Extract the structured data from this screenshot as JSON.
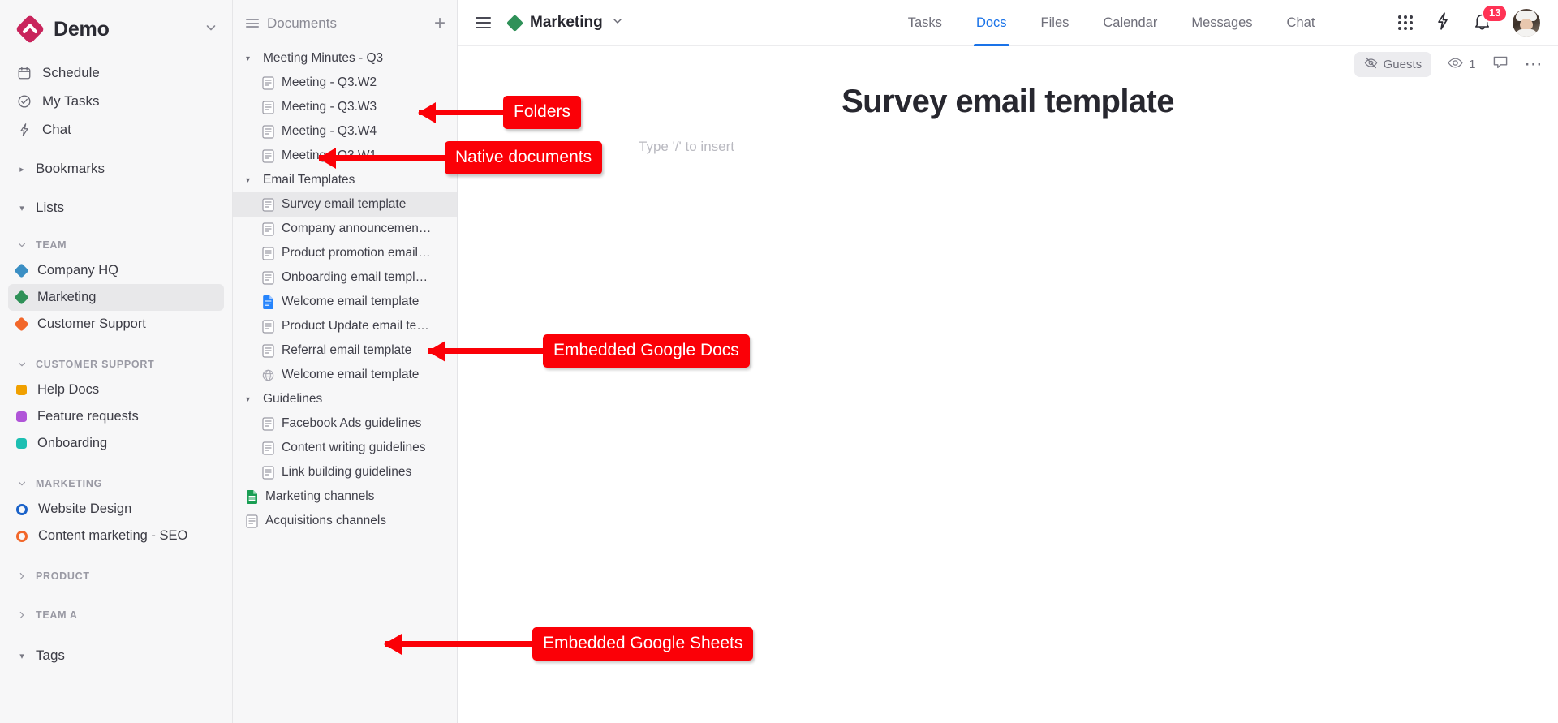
{
  "sidebar": {
    "brand": {
      "name": "Demo",
      "logo_color": "#c9245c",
      "caret": "chevron-down"
    },
    "nav": [
      {
        "label": "Schedule",
        "icon": "calendar-icon"
      },
      {
        "label": "My Tasks",
        "icon": "check-circle-icon"
      },
      {
        "label": "Chat",
        "icon": "lightning-icon"
      }
    ],
    "groups": [
      {
        "label": "Bookmarks",
        "expanded": false
      },
      {
        "label": "Lists",
        "expanded": true
      }
    ],
    "sections": [
      {
        "label": "TEAM",
        "expanded": true,
        "items": [
          {
            "label": "Company HQ",
            "shape": "diamond",
            "color": "#3b8fc4",
            "selected": false
          },
          {
            "label": "Marketing",
            "shape": "diamond",
            "color": "#2f9158",
            "selected": true
          },
          {
            "label": "Customer Support",
            "shape": "diamond",
            "color": "#f2672a",
            "selected": false
          }
        ]
      },
      {
        "label": "CUSTOMER SUPPORT",
        "expanded": true,
        "items": [
          {
            "label": "Help Docs",
            "shape": "square",
            "color": "#f0a000",
            "selected": false
          },
          {
            "label": "Feature requests",
            "shape": "square",
            "color": "#b055d8",
            "selected": false
          },
          {
            "label": "Onboarding",
            "shape": "square",
            "color": "#1dbfb2",
            "selected": false
          }
        ]
      },
      {
        "label": "MARKETING",
        "expanded": true,
        "items": [
          {
            "label": "Website Design",
            "shape": "ring",
            "color": "#1a62c9",
            "selected": false
          },
          {
            "label": "Content marketing - SEO",
            "shape": "ring",
            "color": "#f2672a",
            "selected": false
          }
        ]
      },
      {
        "label": "PRODUCT",
        "expanded": false,
        "items": []
      },
      {
        "label": "TEAM A",
        "expanded": false,
        "items": []
      }
    ],
    "tags_group": {
      "label": "Tags",
      "expanded": true
    }
  },
  "docpanel": {
    "title": "Documents",
    "menu_icon": "hamburger-icon",
    "add_label": "+",
    "tree": [
      {
        "type": "folder",
        "label": "Meeting Minutes - Q3",
        "expanded": true
      },
      {
        "type": "doc",
        "label": "Meeting - Q3.W2",
        "icon": "native-doc-icon",
        "selected": false
      },
      {
        "type": "doc",
        "label": "Meeting - Q3.W3",
        "icon": "native-doc-icon",
        "selected": false
      },
      {
        "type": "doc",
        "label": "Meeting - Q3.W4",
        "icon": "native-doc-icon",
        "selected": false
      },
      {
        "type": "doc",
        "label": "Meeting - Q3.W1",
        "icon": "native-doc-icon",
        "selected": false
      },
      {
        "type": "folder",
        "label": "Email Templates",
        "expanded": true
      },
      {
        "type": "doc",
        "label": "Survey email template",
        "icon": "native-doc-icon",
        "selected": true
      },
      {
        "type": "doc",
        "label": "Company announcement email...",
        "icon": "native-doc-icon",
        "selected": false
      },
      {
        "type": "doc",
        "label": "Product promotion email temp...",
        "icon": "native-doc-icon",
        "selected": false
      },
      {
        "type": "doc",
        "label": "Onboarding email template",
        "icon": "native-doc-icon",
        "selected": false
      },
      {
        "type": "doc",
        "label": "Welcome email template",
        "icon": "google-docs-icon",
        "selected": false
      },
      {
        "type": "doc",
        "label": "Product Update email template",
        "icon": "native-doc-icon",
        "selected": false
      },
      {
        "type": "doc",
        "label": "Referral email template",
        "icon": "native-doc-icon",
        "selected": false
      },
      {
        "type": "doc",
        "label": "Welcome email template",
        "icon": "web-link-icon",
        "selected": false
      },
      {
        "type": "folder",
        "label": "Guidelines",
        "expanded": true
      },
      {
        "type": "doc",
        "label": "Facebook Ads guidelines",
        "icon": "native-doc-icon",
        "selected": false
      },
      {
        "type": "doc",
        "label": "Content writing guidelines",
        "icon": "native-doc-icon",
        "selected": false
      },
      {
        "type": "doc",
        "label": "Link building guidelines",
        "icon": "native-doc-icon",
        "selected": false
      },
      {
        "type": "root-doc",
        "label": "Marketing channels",
        "icon": "google-sheets-icon",
        "selected": false
      },
      {
        "type": "root-doc",
        "label": "Acquisitions channels",
        "icon": "native-doc-icon",
        "selected": false
      }
    ]
  },
  "topbar": {
    "menu_icon": "hamburger-icon",
    "space_name": "Marketing",
    "space_color": "#2f9158",
    "space_caret": "chevron-down",
    "tabs": [
      {
        "label": "Tasks",
        "active": false
      },
      {
        "label": "Docs",
        "active": true
      },
      {
        "label": "Files",
        "active": false
      },
      {
        "label": "Calendar",
        "active": false
      },
      {
        "label": "Messages",
        "active": false
      },
      {
        "label": "Chat",
        "active": false
      }
    ],
    "active_tab_color": "#1a73e8",
    "apps_icon": "grid-apps-icon",
    "bolt_icon": "lightning-icon",
    "notifications": {
      "icon": "bell-icon",
      "count": "13",
      "badge_color": "#ff3355"
    },
    "avatar": "user-avatar"
  },
  "doc_toolbar": {
    "guests_label": "Guests",
    "guests_icon": "eye-off-icon",
    "viewers_icon": "eye-icon",
    "viewers_count": "1",
    "comment_icon": "comment-icon",
    "more_icon": "ellipsis-icon"
  },
  "document": {
    "title": "Survey email template",
    "placeholder": "Type '/' to insert"
  },
  "annotations": {
    "color": "#fb0007",
    "items": [
      {
        "label": "Folders"
      },
      {
        "label": "Native documents"
      },
      {
        "label": "Embedded Google Docs"
      },
      {
        "label": "Embedded Google Sheets"
      }
    ]
  }
}
